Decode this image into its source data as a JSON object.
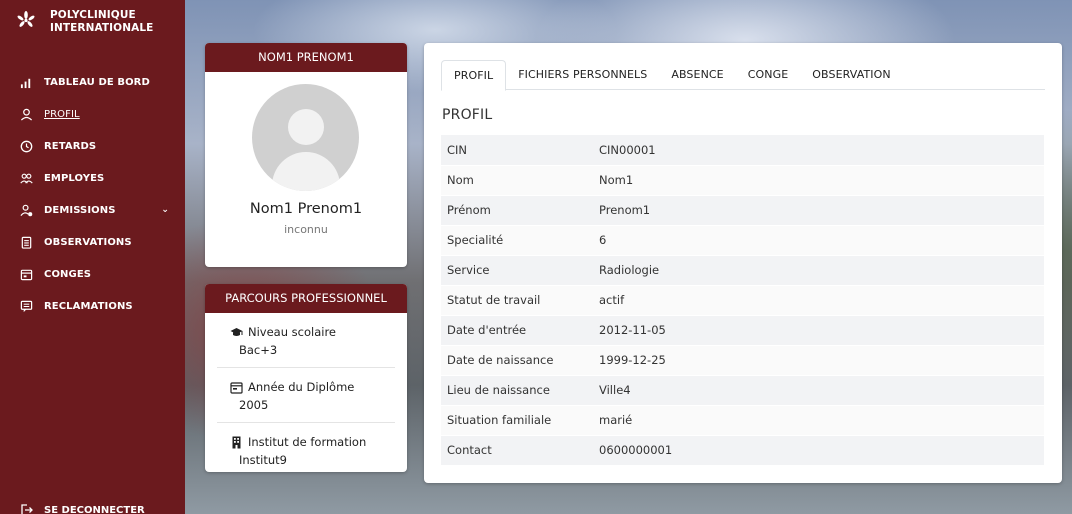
{
  "brand": {
    "name": "POLYCLINIQUE INTERNATIONALE",
    "icon": "flower-logo-icon"
  },
  "nav": {
    "items": [
      {
        "label": "TABLEAU DE BORD",
        "icon": "bar-chart-icon"
      },
      {
        "label": "PROFIL",
        "icon": "user-icon",
        "active": true
      },
      {
        "label": "RETARDS",
        "icon": "clock-icon"
      },
      {
        "label": "EMPLOYES",
        "icon": "users-icon"
      },
      {
        "label": "DEMISSIONS",
        "icon": "user-remove-icon",
        "has_submenu": true
      },
      {
        "label": "OBSERVATIONS",
        "icon": "clipboard-icon"
      },
      {
        "label": "CONGES",
        "icon": "calendar-icon"
      },
      {
        "label": "RECLAMATIONS",
        "icon": "message-icon"
      }
    ],
    "logout": "SE DECONNECTER"
  },
  "profile_card": {
    "header": "NOM1 PRENOM1",
    "name": "Nom1 Prenom1",
    "status": "inconnu"
  },
  "parcours": {
    "header": "PARCOURS PROFESSIONNEL",
    "items": [
      {
        "title": "Niveau scolaire",
        "value": "Bac+3",
        "icon": "graduation-cap-icon"
      },
      {
        "title": "Année du Diplôme",
        "value": "2005",
        "icon": "calendar-icon"
      },
      {
        "title": "Institut de formation",
        "value": "Institut9",
        "icon": "building-icon"
      }
    ]
  },
  "main": {
    "tabs": [
      "PROFIL",
      "FICHIERS PERSONNELS",
      "ABSENCE",
      "CONGE",
      "OBSERVATION"
    ],
    "active_tab": "PROFIL",
    "section_title": "PROFIL",
    "rows": [
      {
        "key": "CIN",
        "value": "CIN00001"
      },
      {
        "key": "Nom",
        "value": "Nom1"
      },
      {
        "key": "Prénom",
        "value": "Prenom1"
      },
      {
        "key": "Specialité",
        "value": "6"
      },
      {
        "key": "Service",
        "value": "Radiologie"
      },
      {
        "key": "Statut de travail",
        "value": "actif"
      },
      {
        "key": "Date d'entrée",
        "value": "2012-11-05"
      },
      {
        "key": "Date de naissance",
        "value": "1999-12-25"
      },
      {
        "key": "Lieu de naissance",
        "value": "Ville4"
      },
      {
        "key": "Situation familiale",
        "value": "marié"
      },
      {
        "key": "Contact",
        "value": "0600000001"
      }
    ]
  },
  "colors": {
    "primary": "#6b1a1e",
    "row_odd": "#f2f3f5",
    "row_even": "#fafafa"
  }
}
